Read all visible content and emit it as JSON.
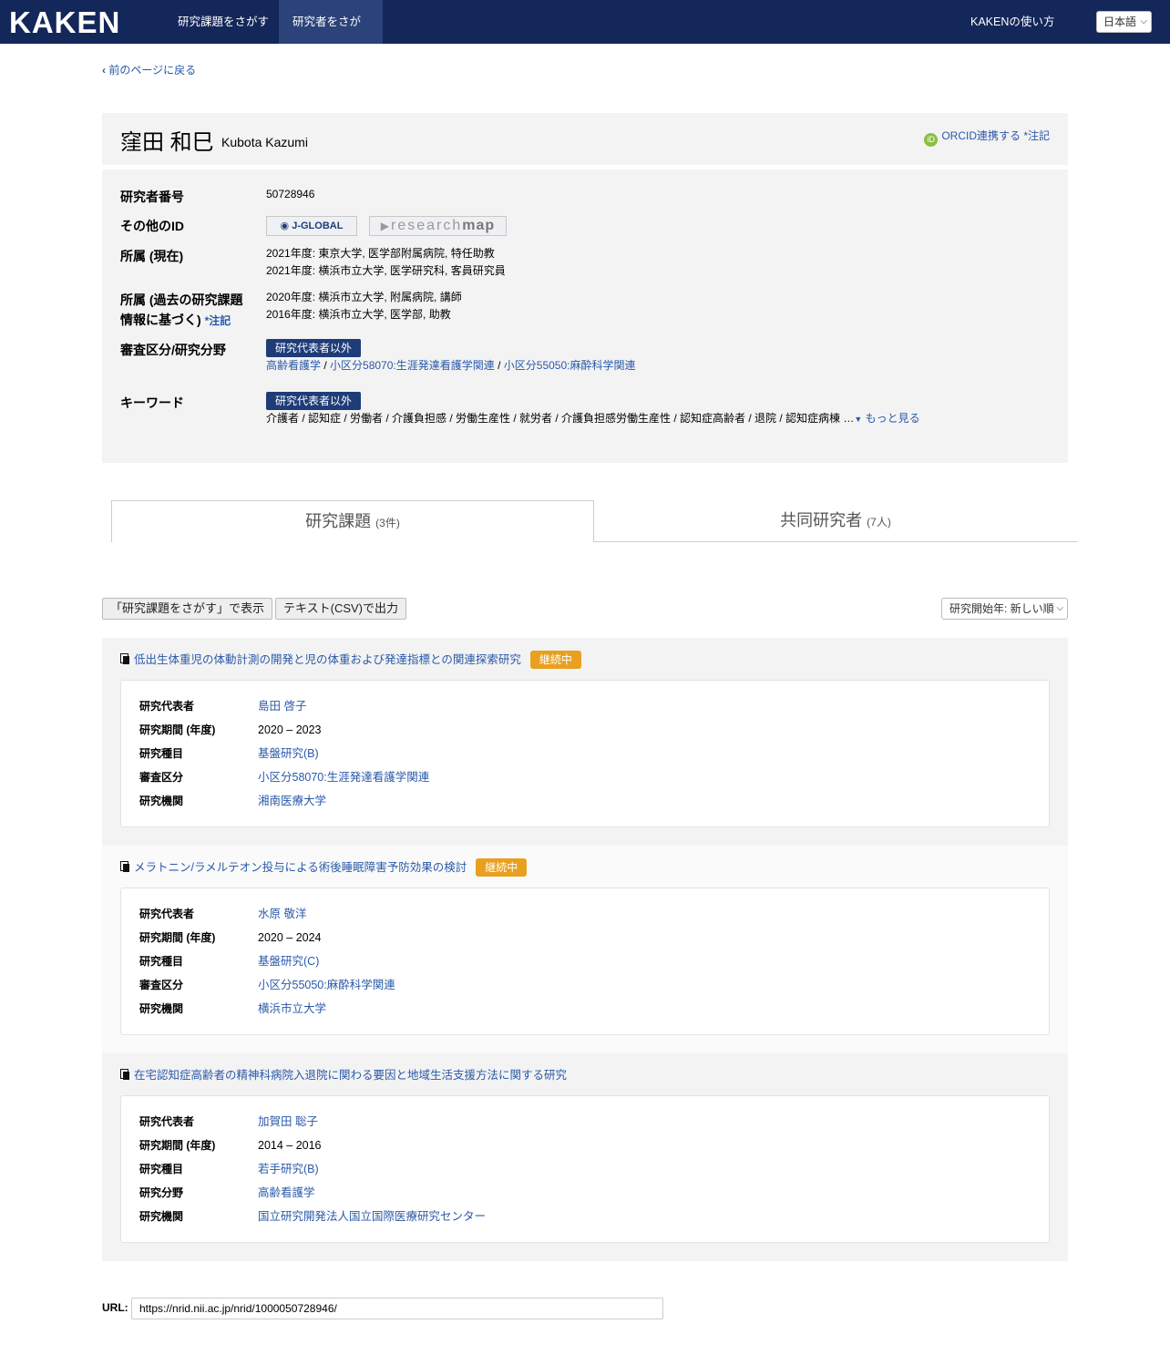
{
  "nav": {
    "logo": "KAKEN",
    "items": [
      "研究課題をさがす",
      "研究者をさがす"
    ],
    "help": "KAKENの使い方",
    "language": "日本語"
  },
  "back_link": "前のページに戻る",
  "researcher": {
    "name_ja": "窪田 和巳",
    "name_en": "Kubota Kazumi",
    "orcid_link": "ORCID連携する",
    "orcid_note": "*注記",
    "fields": {
      "number_label": "研究者番号",
      "number": "50728946",
      "other_id_label": "その他のID",
      "jglobal": "J-GLOBAL",
      "researchmap_a": "research",
      "researchmap_b": "map",
      "affil_current_label": "所属 (現在)",
      "affil_current": [
        "2021年度: 東京大学, 医学部附属病院, 特任助教",
        "2021年度: 横浜市立大学, 医学研究科, 客員研究員"
      ],
      "affil_past_label_1": "所属 (過去の研究課題",
      "affil_past_label_2": "情報に基づく)",
      "affil_past_note": "*注記",
      "affil_past": [
        "2020年度: 横浜市立大学, 附属病院, 講師",
        "2016年度: 横浜市立大学, 医学部, 助教"
      ],
      "review_label": "審査区分/研究分野",
      "review_badge": "研究代表者以外",
      "review_items": [
        "高齢看護学",
        "小区分58070:生涯発達看護学関連",
        "小区分55050:麻酔科学関連"
      ],
      "keyword_label": "キーワード",
      "keyword_badge": "研究代表者以外",
      "keywords": "介護者 / 認知症 / 労働者 / 介護負担感 / 労働生産性 / 就労者 / 介護負担感労働生産性 / 認知症高齢者 / 退院 / 認知症病棟 …",
      "more": "もっと見る"
    }
  },
  "tabs": [
    {
      "label": "研究課題",
      "count": "(3件)"
    },
    {
      "label": "共同研究者",
      "count": "(7人)"
    }
  ],
  "toolbar": {
    "show_btn": "「研究課題をさがす」で表示",
    "csv_btn": "テキスト(CSV)で出力",
    "sort": "研究開始年: 新しい順"
  },
  "projects": [
    {
      "title": "低出生体重児の体動計測の開発と児の体重および発達指標との関連探索研究",
      "status": "継続中",
      "rows": [
        {
          "k": "研究代表者",
          "v": "島田 啓子",
          "link": true
        },
        {
          "k": "研究期間 (年度)",
          "v": "2020 – 2023",
          "link": false
        },
        {
          "k": "研究種目",
          "v": "基盤研究(B)",
          "link": true
        },
        {
          "k": "審査区分",
          "v": "小区分58070:生涯発達看護学関連",
          "link": true
        },
        {
          "k": "研究機関",
          "v": "湘南医療大学",
          "link": true
        }
      ]
    },
    {
      "title": "メラトニン/ラメルテオン投与による術後睡眠障害予防効果の検討",
      "status": "継続中",
      "rows": [
        {
          "k": "研究代表者",
          "v": "水原 敬洋",
          "link": true
        },
        {
          "k": "研究期間 (年度)",
          "v": "2020 – 2024",
          "link": false
        },
        {
          "k": "研究種目",
          "v": "基盤研究(C)",
          "link": true
        },
        {
          "k": "審査区分",
          "v": "小区分55050:麻酔科学関連",
          "link": true
        },
        {
          "k": "研究機関",
          "v": "横浜市立大学",
          "link": true
        }
      ]
    },
    {
      "title": "在宅認知症高齢者の精神科病院入退院に関わる要因と地域生活支援方法に関する研究",
      "status": "",
      "rows": [
        {
          "k": "研究代表者",
          "v": "加賀田 聡子",
          "link": true
        },
        {
          "k": "研究期間 (年度)",
          "v": "2014 – 2016",
          "link": false
        },
        {
          "k": "研究種目",
          "v": "若手研究(B)",
          "link": true
        },
        {
          "k": "研究分野",
          "v": "高齢看護学",
          "link": true
        },
        {
          "k": "研究機関",
          "v": "国立研究開発法人国立国際医療研究センター",
          "link": true
        }
      ]
    }
  ],
  "url": {
    "label": "URL:",
    "value": "https://nrid.nii.ac.jp/nrid/1000050728946/"
  }
}
